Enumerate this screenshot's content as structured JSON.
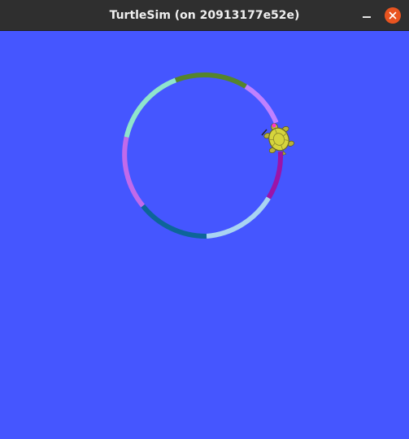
{
  "window": {
    "title": "TurtleSim (on 20913177e52e)"
  },
  "canvas": {
    "background": "#4556ff"
  },
  "trail": {
    "segment_colors": [
      "#55842c",
      "#c081ff",
      "#9b14a8",
      "#a9d4f2",
      "#0d6599",
      "#c16aeb",
      "#8fe4cc"
    ]
  },
  "turtle": {
    "shell_color": "#d6d43c",
    "pen_color": "#ff33cc"
  }
}
